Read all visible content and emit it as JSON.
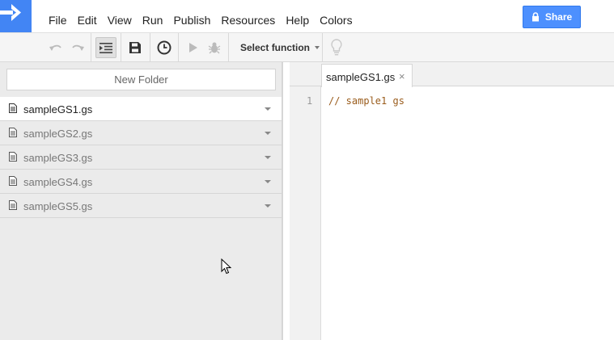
{
  "menu": [
    "File",
    "Edit",
    "View",
    "Run",
    "Publish",
    "Resources",
    "Help",
    "Colors"
  ],
  "share_label": "Share",
  "toolbar": {
    "select_function": "Select function",
    "icons": [
      "undo-icon",
      "redo-icon",
      "indent-icon",
      "save-icon",
      "clock-icon",
      "run-icon",
      "debug-icon",
      "lightbulb-icon"
    ]
  },
  "sidebar": {
    "new_folder": "New Folder",
    "files": [
      {
        "name": "sampleGS1.gs",
        "active": true
      },
      {
        "name": "sampleGS2.gs",
        "active": false
      },
      {
        "name": "sampleGS3.gs",
        "active": false
      },
      {
        "name": "sampleGS4.gs",
        "active": false
      },
      {
        "name": "sampleGS5.gs",
        "active": false
      }
    ]
  },
  "editor": {
    "tab_label": "sampleGS1.gs",
    "tab_close": "×",
    "line_number": "1",
    "code_line": "// sample1 gs"
  },
  "colors": {
    "brand_blue": "#4285f4",
    "share_blue": "#4d90fe",
    "comment_color": "#9a5c1c"
  }
}
